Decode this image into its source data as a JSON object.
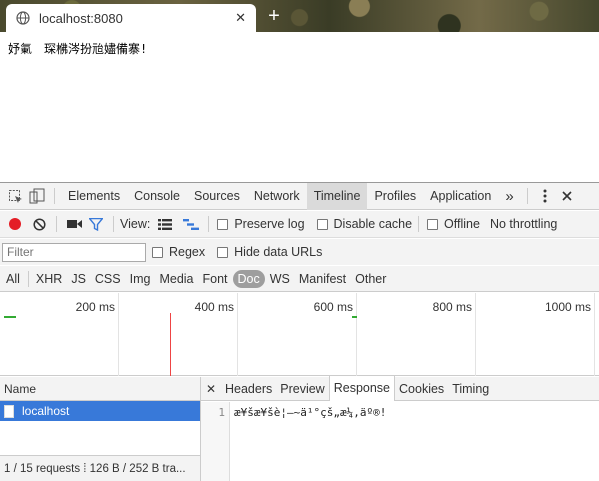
{
  "browser": {
    "tab_title": "localhost:8080",
    "tab_close": "✕",
    "new_tab": "+"
  },
  "page": {
    "text": "妤氭　琛梻涔扮兘嬧備寨!"
  },
  "devtools": {
    "tabs": [
      "Elements",
      "Console",
      "Sources",
      "Network",
      "Timeline",
      "Profiles",
      "Application"
    ],
    "active_tab": "Timeline",
    "more": "»",
    "toolbar": {
      "view_label": "View:",
      "preserve_log": "Preserve log",
      "disable_cache": "Disable cache",
      "offline": "Offline",
      "throttling": "No throttling"
    },
    "filter": {
      "placeholder": "Filter",
      "regex": "Regex",
      "hide_data_urls": "Hide data URLs"
    },
    "types": [
      "All",
      "XHR",
      "JS",
      "CSS",
      "Img",
      "Media",
      "Font",
      "Doc",
      "WS",
      "Manifest",
      "Other"
    ],
    "active_type": "Doc",
    "timeline_ticks": [
      "200 ms",
      "400 ms",
      "600 ms",
      "800 ms",
      "1000 ms"
    ],
    "requests": {
      "header": "Name",
      "items": [
        "localhost"
      ],
      "status": "1 / 15 requests ⁞ 126 B / 252 B tra..."
    },
    "detail": {
      "close": "✕",
      "tabs": [
        "Headers",
        "Preview",
        "Response",
        "Cookies",
        "Timing"
      ],
      "active": "Response",
      "line_number": "1",
      "response_text": "æ¥šæ¥šè¦—~ä¹°çš„æ¼‚äº®!"
    },
    "colors": {
      "record": "#e41e26",
      "selected_row": "#3879d9",
      "filter_icon": "#3879d9"
    }
  }
}
